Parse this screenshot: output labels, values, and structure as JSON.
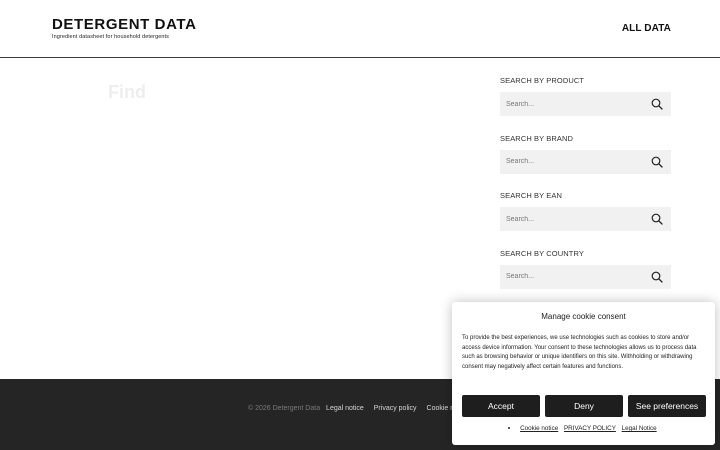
{
  "header": {
    "logo_title": "DETERGENT DATA",
    "logo_subtitle": "Ingredient datasheet for household detergents",
    "nav_all": "ALL DATA"
  },
  "main": {
    "find_title": "Find"
  },
  "sidebar": {
    "blocks": [
      {
        "label": "SEARCH BY PRODUCT",
        "placeholder": "Search..."
      },
      {
        "label": "SEARCH BY BRAND",
        "placeholder": "Search..."
      },
      {
        "label": "SEARCH BY EAN",
        "placeholder": "Search..."
      },
      {
        "label": "SEARCH BY COUNTRY",
        "placeholder": "Search..."
      }
    ],
    "icon": "search-icon"
  },
  "footer": {
    "copyright": "© 2026 Detergent Data",
    "links": [
      "Legal notice",
      "Privacy policy",
      "Cookie n"
    ]
  },
  "cookie": {
    "title": "Manage cookie consent",
    "text": "To provide the best experiences, we use technologies such as cookies to store and/or access device information. Your consent to these technologies allows us to process data such as browsing behavior or unique identifiers on this site. Withholding or withdrawing consent may negatively affect certain features and functions.",
    "accept": "Accept",
    "deny": "Deny",
    "preferences": "See preferences",
    "links": [
      "Cookie notice",
      "PRIVACY POLICY",
      "Legal Notice"
    ]
  },
  "colors": {
    "footer_bg": "#252525",
    "button_bg": "#1e1e1e",
    "search_bg": "#f1f1f1"
  }
}
